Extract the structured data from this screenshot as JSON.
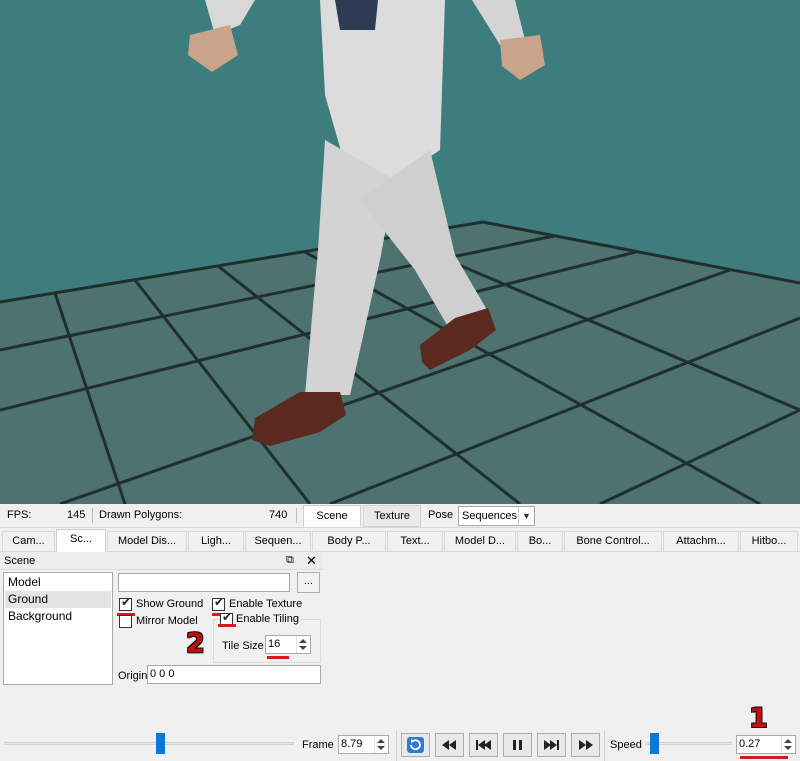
{
  "status": {
    "fps_label": "FPS:",
    "fps_value": "145",
    "polygons_label": "Drawn Polygons:",
    "polygons_value": "740",
    "scene_btn": "Scene",
    "texture_btn": "Texture",
    "pose_label": "Pose",
    "pose_value": "Sequences"
  },
  "tabs": [
    "Cam...",
    "Sc...",
    "Model Dis...",
    "Ligh...",
    "Sequen...",
    "Body P...",
    "Text...",
    "Model D...",
    "Bo...",
    "Bone Control...",
    "Attachm...",
    "Hitbo..."
  ],
  "scene": {
    "title": "Scene",
    "items": [
      "Model",
      "Ground",
      "Background"
    ],
    "texture_path": "",
    "browse_label": "...",
    "show_ground": "Show Ground",
    "enable_texture": "Enable Texture",
    "mirror_model": "Mirror Model",
    "enable_tiling": "Enable Tiling",
    "tile_size_label": "Tile Size",
    "tile_size_value": "16",
    "origin_label": "Origin",
    "origin_value": "0 0 0"
  },
  "controls": {
    "frame_label": "Frame",
    "frame_value": "8.79",
    "speed_label": "Speed",
    "speed_value": "0.27"
  },
  "annotations": {
    "marker_1": "1",
    "marker_2": "2"
  },
  "colors": {
    "sky": "#3e7d7e",
    "ground": "#4f7370",
    "accent": "#0a78d7",
    "annotation": "#d21d1d"
  }
}
